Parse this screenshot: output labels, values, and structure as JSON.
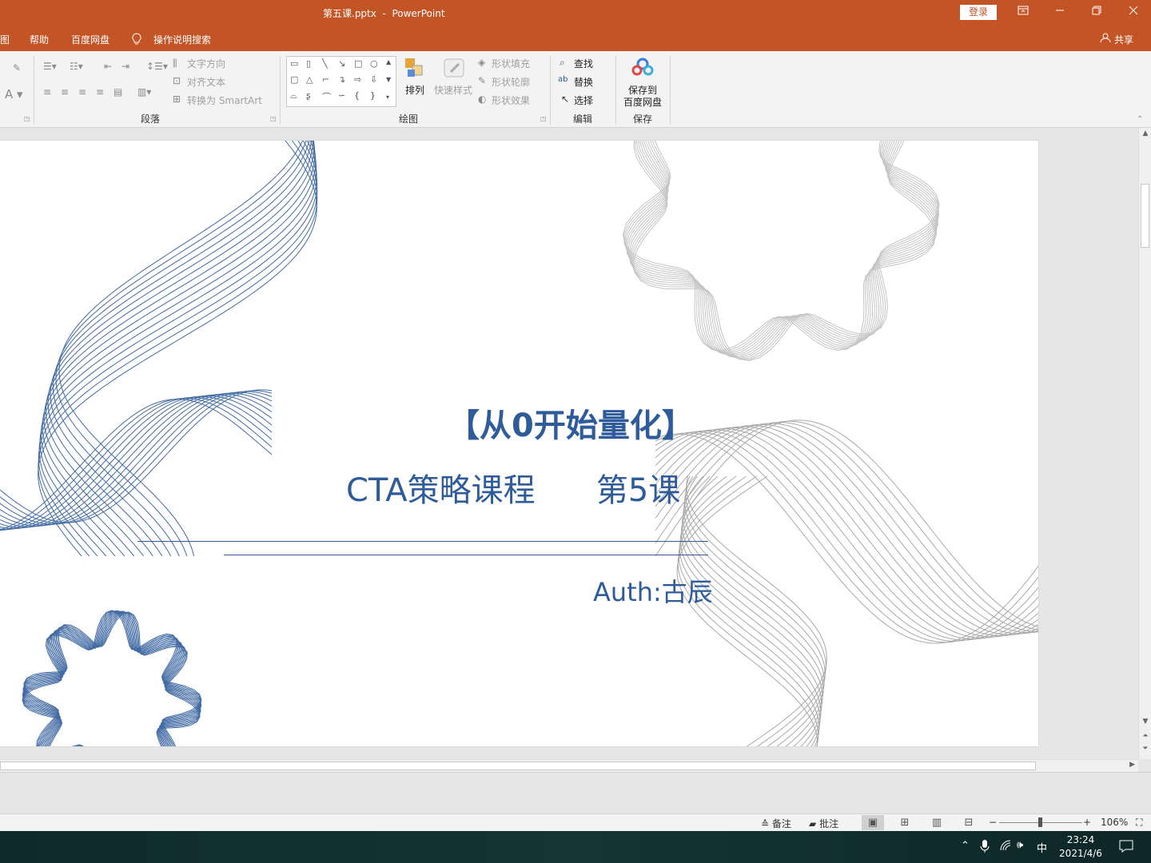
{
  "window": {
    "title": "第五课.pptx  -  PowerPoint",
    "login_label": "登录",
    "buttons": [
      "ribbon-display-icon",
      "minimize-icon",
      "restore-icon",
      "close-icon"
    ]
  },
  "menubar": {
    "items": [
      "图",
      "帮助",
      "百度网盘"
    ],
    "tell_me": "操作说明搜索",
    "share": "共享"
  },
  "ribbon": {
    "paragraph": {
      "text_direction": "文字方向",
      "align_text": "对齐文本",
      "convert_smartart": "转换为 SmartArt",
      "label": "段落"
    },
    "drawing": {
      "arrange": "排列",
      "quick_styles": "快速样式",
      "shape_fill": "形状填充",
      "shape_outline": "形状轮廓",
      "shape_effects": "形状效果",
      "label": "绘图"
    },
    "editing": {
      "find": "查找",
      "replace": "替换",
      "select": "选择",
      "label": "编辑"
    },
    "save": {
      "save_baidu": "保存到",
      "save_baidu_2": "百度网盘",
      "label": "保存"
    }
  },
  "slide": {
    "title": "【从0开始量化】",
    "subtitle": "CTA策略课程      第5课",
    "author": "Auth:古辰"
  },
  "statusbar": {
    "notes": "备注",
    "comments": "批注",
    "zoom_minus": "−",
    "zoom_plus": "+",
    "zoom": "106%"
  },
  "taskbar": {
    "ime": "中",
    "time": "23:24",
    "date": "2021/4/6"
  },
  "colors": {
    "accent": "#c35426",
    "slide_text": "#2e5b9a",
    "wave_blue": "#2e5b9a",
    "wave_gray": "#b0b0b0"
  }
}
